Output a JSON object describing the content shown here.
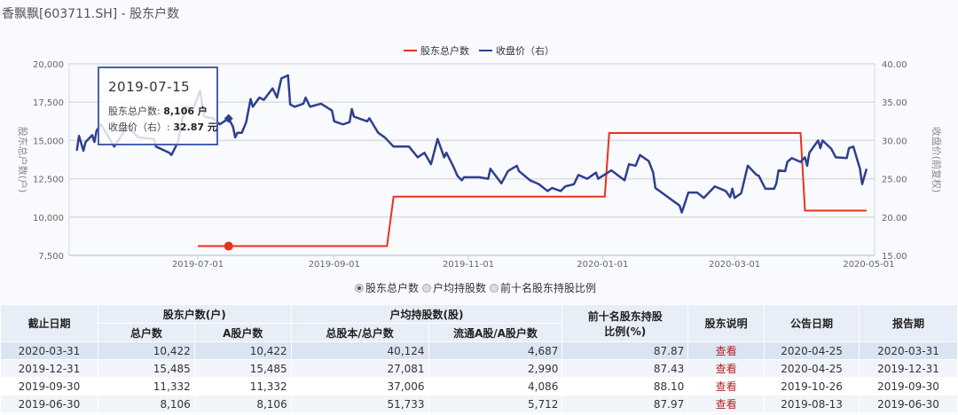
{
  "title": "香飘飘[603711.SH] - 股东户数",
  "tooltip": {
    "date": "2019-07-15",
    "holders_label": "股东总户数:",
    "holders_value": "8,106 户",
    "price_label": "收盘价（右）:",
    "price_value": "32.87 元"
  },
  "radio_options": [
    {
      "label": "股东总户数",
      "selected": true
    },
    {
      "label": "户均持股数",
      "selected": false
    },
    {
      "label": "前十名股东持股比例",
      "selected": false
    }
  ],
  "chart_data": {
    "type": "line",
    "start_date": "2019-07-01",
    "x_unit": "days since start_date",
    "legend": [
      "股东总户数",
      "收盘价（右）"
    ],
    "legend_placement": "top-right",
    "ylabel_left": "股东总户数(户)",
    "ylabel_right": "收盘价(前复权)",
    "ylim_left": [
      7500,
      20000
    ],
    "ylim_right": [
      15,
      40
    ],
    "xlim_days": [
      -57,
      310
    ],
    "yticks_left": [
      "7,500",
      "10,000",
      "12,500",
      "15,000",
      "17,500",
      "20,000"
    ],
    "yticks_right": [
      "15.00",
      "20.00",
      "25.00",
      "30.00",
      "35.00",
      "40.00"
    ],
    "xticks": [
      {
        "label": "2019-07-01",
        "day": 0
      },
      {
        "label": "2019-09-01",
        "day": 62
      },
      {
        "label": "2019-11-01",
        "day": 123
      },
      {
        "label": "2020-01-01",
        "day": 184
      },
      {
        "label": "2020-03-01",
        "day": 244
      },
      {
        "label": "2020-05-01",
        "day": 305
      }
    ],
    "grid": true,
    "colors": {
      "holders": "#e8321a",
      "price": "#2f3f8f"
    },
    "series": [
      {
        "name": "股东总户数",
        "axis": "left",
        "points": [
          [
            0,
            8106
          ],
          [
            86,
            8106
          ],
          [
            89,
            11332
          ],
          [
            185,
            11332
          ],
          [
            187,
            15485
          ],
          [
            274,
            15485
          ],
          [
            276,
            10422
          ],
          [
            304,
            10422
          ]
        ],
        "marker_day": 14
      },
      {
        "name": "收盘价（右）",
        "axis": "right",
        "points": [
          [
            -55,
            28.66
          ],
          [
            -54,
            30.6
          ],
          [
            -52,
            28.66
          ],
          [
            -51,
            29.8
          ],
          [
            -48,
            30.7
          ],
          [
            -47,
            29.8
          ],
          [
            -46,
            31.3
          ],
          [
            -44,
            32.1
          ],
          [
            -38,
            29.2
          ],
          [
            -32,
            31.8
          ],
          [
            -27,
            30.4
          ],
          [
            -20,
            30.2
          ],
          [
            -19,
            29.2
          ],
          [
            -13,
            28.4
          ],
          [
            -12,
            28.1
          ],
          [
            -9,
            29.8
          ],
          [
            -6,
            34.4
          ],
          [
            -2,
            34.2
          ],
          [
            1,
            36.5
          ],
          [
            3,
            33.1
          ],
          [
            7,
            32.9
          ],
          [
            10,
            32.1
          ],
          [
            14,
            32.87
          ],
          [
            16,
            31.8
          ],
          [
            17,
            30.4
          ],
          [
            18,
            31.0
          ],
          [
            20,
            31.0
          ],
          [
            22,
            32.4
          ],
          [
            24,
            35.4
          ],
          [
            25,
            34.4
          ],
          [
            28,
            35.6
          ],
          [
            30,
            35.3
          ],
          [
            34,
            36.8
          ],
          [
            36,
            35.6
          ],
          [
            38,
            38.1
          ],
          [
            41,
            38.5
          ],
          [
            42,
            34.7
          ],
          [
            44,
            34.4
          ],
          [
            48,
            34.8
          ],
          [
            49,
            35.6
          ],
          [
            51,
            34.4
          ],
          [
            56,
            34.8
          ],
          [
            61,
            33.9
          ],
          [
            62,
            32.5
          ],
          [
            66,
            32.1
          ],
          [
            69,
            32.4
          ],
          [
            70,
            34.1
          ],
          [
            71,
            33.1
          ],
          [
            77,
            32.5
          ],
          [
            78,
            32.9
          ],
          [
            82,
            31.0
          ],
          [
            85,
            30.4
          ],
          [
            89,
            29.2
          ],
          [
            96,
            29.2
          ],
          [
            100,
            27.8
          ],
          [
            103,
            28.4
          ],
          [
            106,
            26.9
          ],
          [
            109,
            30.2
          ],
          [
            112,
            27.8
          ],
          [
            113,
            28.4
          ],
          [
            116,
            26.7
          ],
          [
            118,
            25.4
          ],
          [
            120,
            24.8
          ],
          [
            121,
            25.2
          ],
          [
            128,
            25.2
          ],
          [
            132,
            25.0
          ],
          [
            133,
            26.3
          ],
          [
            138,
            24.4
          ],
          [
            141,
            26.0
          ],
          [
            145,
            26.7
          ],
          [
            146,
            26.0
          ],
          [
            151,
            24.8
          ],
          [
            155,
            24.3
          ],
          [
            159,
            23.4
          ],
          [
            161,
            23.8
          ],
          [
            165,
            23.4
          ],
          [
            167,
            24.0
          ],
          [
            171,
            24.3
          ],
          [
            173,
            25.5
          ],
          [
            177,
            25.0
          ],
          [
            181,
            25.8
          ],
          [
            182,
            25.0
          ],
          [
            188,
            26.1
          ],
          [
            194,
            24.8
          ],
          [
            196,
            26.9
          ],
          [
            199,
            26.7
          ],
          [
            201,
            28.1
          ],
          [
            205,
            27.3
          ],
          [
            207,
            25.8
          ],
          [
            208,
            23.8
          ],
          [
            219,
            21.5
          ],
          [
            220,
            20.6
          ],
          [
            223,
            23.2
          ],
          [
            227,
            23.2
          ],
          [
            230,
            22.5
          ],
          [
            235,
            24.0
          ],
          [
            240,
            23.4
          ],
          [
            242,
            22.6
          ],
          [
            243,
            23.7
          ],
          [
            244,
            22.5
          ],
          [
            247,
            23.1
          ],
          [
            250,
            26.7
          ],
          [
            254,
            25.5
          ],
          [
            255,
            25.4
          ],
          [
            258,
            23.7
          ],
          [
            262,
            23.7
          ],
          [
            263,
            24.4
          ],
          [
            264,
            26.1
          ],
          [
            267,
            26.0
          ],
          [
            268,
            27.2
          ],
          [
            270,
            27.7
          ],
          [
            274,
            27.2
          ],
          [
            276,
            27.8
          ],
          [
            277,
            26.7
          ],
          [
            278,
            28.4
          ],
          [
            282,
            30.0
          ],
          [
            283,
            29.0
          ],
          [
            284,
            30.0
          ],
          [
            288,
            28.9
          ],
          [
            290,
            27.8
          ],
          [
            295,
            27.7
          ],
          [
            296,
            29.0
          ],
          [
            298,
            29.2
          ],
          [
            301,
            26.3
          ],
          [
            302,
            24.3
          ],
          [
            304,
            26.3
          ]
        ],
        "marker_day": 14
      }
    ]
  },
  "table": {
    "headers": {
      "date": "截止日期",
      "holders_group": "股东户数(户)",
      "total": "总户数",
      "a_holders": "A股户数",
      "avg_group": "户均持股数(股)",
      "avg_total": "总股本/总户数",
      "avg_float": "流通A股/A股户数",
      "top10_1": "前十名股东持股",
      "top10_2": "比例(%)",
      "note": "股东说明",
      "pub": "公告日期",
      "report": "报告期"
    },
    "rows": [
      {
        "date": "2020-03-31",
        "total": "10,422",
        "a": "10,422",
        "avg_total": "40,124",
        "avg_float": "4,687",
        "top10": "87.87",
        "link": "查看",
        "pub": "2020-04-25",
        "report": "2020-03-31"
      },
      {
        "date": "2019-12-31",
        "total": "15,485",
        "a": "15,485",
        "avg_total": "27,081",
        "avg_float": "2,990",
        "top10": "87.43",
        "link": "查看",
        "pub": "2020-04-25",
        "report": "2019-12-31"
      },
      {
        "date": "2019-09-30",
        "total": "11,332",
        "a": "11,332",
        "avg_total": "37,006",
        "avg_float": "4,086",
        "top10": "88.10",
        "link": "查看",
        "pub": "2019-10-26",
        "report": "2019-09-30"
      },
      {
        "date": "2019-06-30",
        "total": "8,106",
        "a": "8,106",
        "avg_total": "51,733",
        "avg_float": "5,712",
        "top10": "87.97",
        "link": "查看",
        "pub": "2019-08-13",
        "report": "2019-06-30"
      }
    ]
  }
}
